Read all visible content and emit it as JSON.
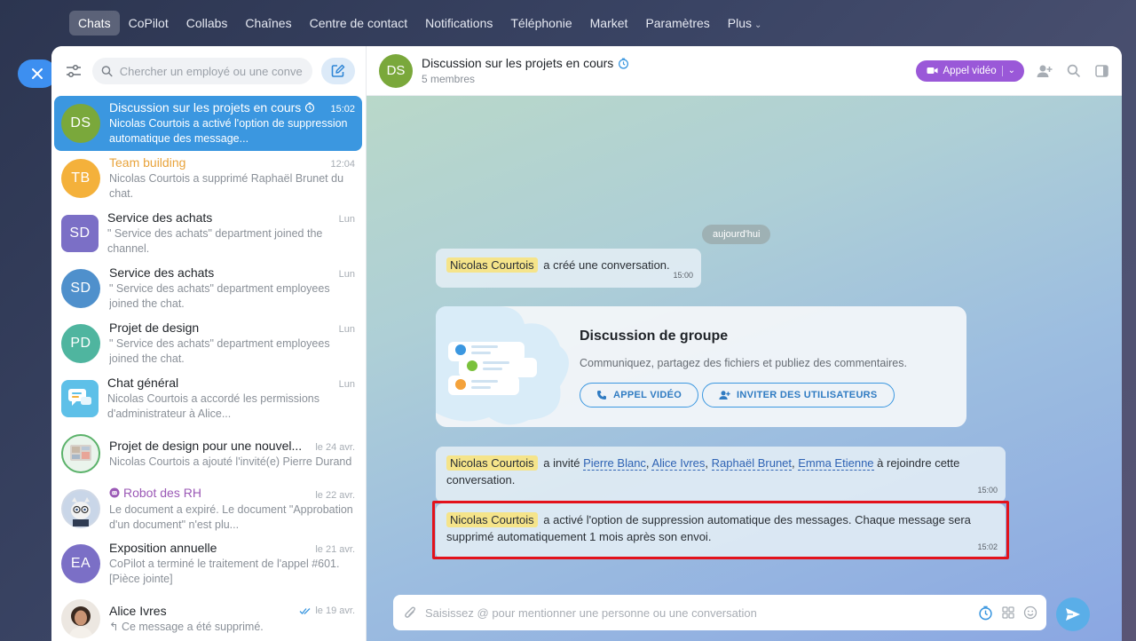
{
  "topnav": {
    "items": [
      {
        "label": "Chats",
        "active": true
      },
      {
        "label": "CoPilot"
      },
      {
        "label": "Collabs"
      },
      {
        "label": "Chaînes"
      },
      {
        "label": "Centre de contact"
      },
      {
        "label": "Notifications"
      },
      {
        "label": "Téléphonie"
      },
      {
        "label": "Market"
      },
      {
        "label": "Paramètres"
      },
      {
        "label": "Plus"
      }
    ]
  },
  "close_button": {
    "icon": "close-icon",
    "label": "×"
  },
  "sidebar": {
    "search_placeholder": "Chercher un employé ou une conve",
    "chats": [
      {
        "initials": "DS",
        "name": "Discussion sur les projets en cours",
        "time": "15:02",
        "preview": "Nicolas Courtois a activé l'option de suppression automatique des message...",
        "color": "#7aa83b",
        "active": true,
        "timer": true
      },
      {
        "initials": "TB",
        "name": "Team building",
        "time": "12:04",
        "preview": "Nicolas Courtois a supprimé Raphaël Brunet du chat.",
        "color": "#f4b13b",
        "style": "orange"
      },
      {
        "initials": "SD",
        "name": "Service des achats",
        "time": "Lun",
        "preview": "\" Service des achats\" department joined the channel.",
        "color": "#7b6fc6",
        "square": true
      },
      {
        "initials": "SD",
        "name": "Service des achats",
        "time": "Lun",
        "preview": "\" Service des achats\" department employees joined the chat.",
        "color": "#4f90cc"
      },
      {
        "initials": "PD",
        "name": "Projet de design",
        "time": "Lun",
        "preview": "\" Service des achats\" department employees joined the chat.",
        "color": "#4fb59f"
      },
      {
        "initials": "",
        "name": "Chat général",
        "time": "Lun",
        "preview": "Nicolas Courtois a accordé les permissions d'administrateur à Alice...",
        "color": "#5ec0e8",
        "square": true,
        "icon": "general-chat-icon"
      },
      {
        "initials": "",
        "name": "Projet de design pour une nouvel...",
        "time": "le 24 avr.",
        "preview": "Nicolas Courtois a ajouté l'invité(e) Pierre Durand",
        "color": "#e9f3ea",
        "icon": "project-image-icon"
      },
      {
        "initials": "",
        "name": "Robot des RH",
        "time": "le 22 avr.",
        "preview": "Le document a expiré. Le document \"Approbation d'un document\" n'est plu...",
        "color": "#cfd8e6",
        "style": "purple",
        "icon": "robot-icon"
      },
      {
        "initials": "EA",
        "name": "Exposition annuelle",
        "time": "le 21 avr.",
        "preview": "CoPilot a terminé le traitement de l'appel #601. [Pièce jointe]",
        "color": "#7b6fc6"
      },
      {
        "initials": "",
        "name": "Alice Ivres",
        "time": "le 19 avr.",
        "preview": "↰ Ce message a été supprimé.",
        "color": "#e9e3dc",
        "icon": "user-photo-icon",
        "read": true
      }
    ]
  },
  "header": {
    "initials": "DS",
    "title": "Discussion sur les projets en cours",
    "subtitle": "5 membres",
    "video_label": "Appel vidéo"
  },
  "chat": {
    "date_divider": "aujourd'hui",
    "msg1": {
      "author": "Nicolas Courtois",
      "text": "a créé une conversation.",
      "time": "15:00"
    },
    "group_card": {
      "title": "Discussion de groupe",
      "description": "Communiquez, partagez des fichiers et publiez des commentaires.",
      "btn_call": "APPEL VIDÉO",
      "btn_invite": "INVITER DES UTILISATEURS"
    },
    "msg2": {
      "author": "Nicolas Courtois",
      "text_before": "a invité",
      "users": [
        "Pierre Blanc",
        "Alice Ivres",
        "Raphaël Brunet",
        "Emma Etienne"
      ],
      "sep1": ",",
      "sep2": ",",
      "sep3": ",",
      "text_after": "à rejoindre cette conversation.",
      "time": "15:00"
    },
    "msg3": {
      "author": "Nicolas Courtois",
      "text": "a activé l'option de suppression automatique des messages. Chaque message sera supprimé automatiquement 1 mois après son envoi.",
      "time": "15:02"
    }
  },
  "composer": {
    "placeholder": "Saisissez @ pour mentionner une personne ou une conversation"
  },
  "colors": {
    "accent": "#3b97e0",
    "video_button": "#9a58d8",
    "highlight_box": "#e3121b",
    "mention_highlight": "#f5e48a"
  }
}
